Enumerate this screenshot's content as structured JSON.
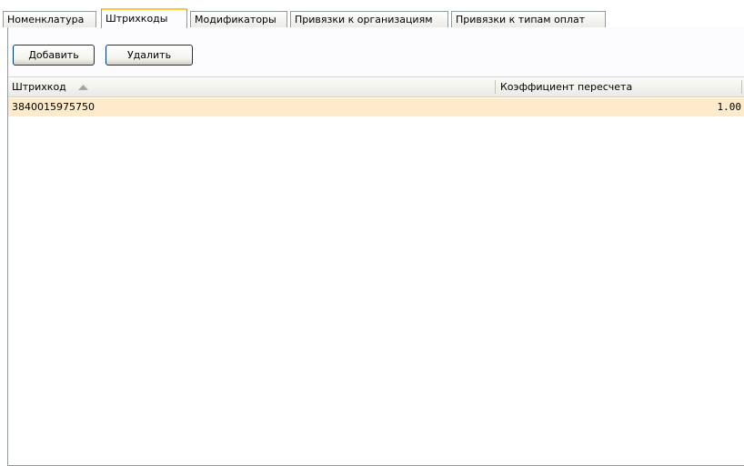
{
  "tabs": [
    {
      "label": "Номенклатура",
      "active": false
    },
    {
      "label": "Штрихкоды",
      "active": true
    },
    {
      "label": "Модификаторы",
      "active": false
    },
    {
      "label": "Привязки к организациям",
      "active": false
    },
    {
      "label": "Привязки к типам оплат",
      "active": false
    }
  ],
  "toolbar": {
    "add_label": "Добавить",
    "delete_label": "Удалить"
  },
  "grid": {
    "columns": [
      {
        "label": "Штрихкод",
        "sorted": "ascending"
      },
      {
        "label": "Коэффициент пересчета"
      }
    ],
    "rows": [
      {
        "barcode": "3840015975750",
        "coefficient": "1.00",
        "selected": true
      }
    ]
  },
  "colors": {
    "active_tab_accent": "#ffc83c",
    "selected_row": "#fdebcb",
    "border": "#919b9c"
  }
}
